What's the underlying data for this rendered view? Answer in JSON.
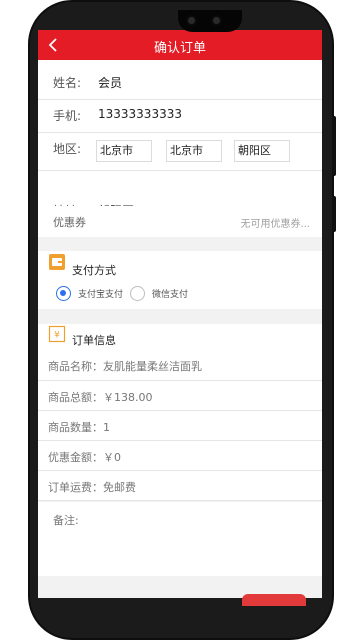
{
  "header": {
    "title": "确认订单"
  },
  "form": {
    "name_label": "姓名:",
    "name_value": "会员",
    "phone_label": "手机:",
    "phone_value": "13333333333",
    "region_label": "地区:",
    "province": "北京市",
    "city": "北京市",
    "district": "朝阳区",
    "address_label": "地址:",
    "address_value": "朝阳区"
  },
  "coupon": {
    "label": "优惠券",
    "hint": "无可用优惠券..."
  },
  "payment": {
    "title": "支付方式",
    "options": [
      {
        "label": "支付宝支付",
        "selected": true
      },
      {
        "label": "微信支付",
        "selected": false
      }
    ]
  },
  "order_info": {
    "title": "订单信息",
    "product_name": "商品名称：友肌能量柔丝洁面乳",
    "total": "商品总额：￥138.00",
    "quantity": "商品数量：1",
    "discount": "优惠金额：￥0",
    "shipping": "订单运费：免邮费",
    "remark_label": "备注:"
  },
  "colors": {
    "accent": "#e31c25",
    "icon_orange": "#f0a02e",
    "radio_blue": "#2d6ff0"
  }
}
